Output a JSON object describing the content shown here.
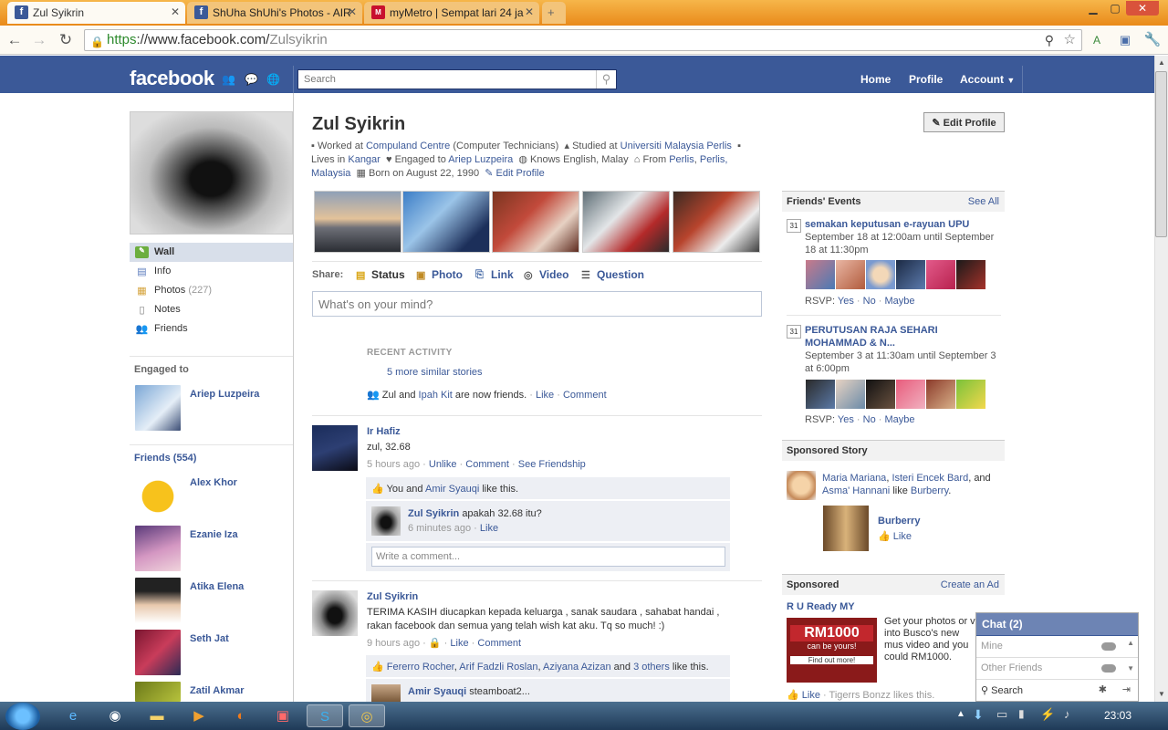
{
  "browser": {
    "tabs": [
      {
        "title": "Zul Syikrin",
        "icon": "facebook-icon"
      },
      {
        "title": "ShUha ShUhi's Photos - AIR",
        "icon": "facebook-icon"
      },
      {
        "title": "myMetro | Sempat lari 24 ja",
        "icon": "mymetro-icon"
      }
    ],
    "url_scheme": "https",
    "url_main": "://www.facebook.com/",
    "url_path": "Zulsyikrin"
  },
  "fb": {
    "logo": "facebook",
    "search_placeholder": "Search",
    "nav": {
      "home": "Home",
      "profile": "Profile",
      "account": "Account"
    }
  },
  "leftnav": {
    "items": [
      {
        "label": "Wall",
        "icon": "wall-icon"
      },
      {
        "label": "Info",
        "icon": "info-icon"
      },
      {
        "label": "Photos",
        "count": "(227)",
        "icon": "photos-icon"
      },
      {
        "label": "Notes",
        "icon": "notes-icon"
      },
      {
        "label": "Friends",
        "icon": "friends-icon"
      }
    ],
    "engaged_heading": "Engaged to",
    "engaged_name": "Ariep Luzpeira",
    "friends_heading": "Friends (554)",
    "friends": [
      "Alex Khor",
      "Ezanie Iza",
      "Atika Elena",
      "Seth Jat",
      "Zatil Akmar"
    ]
  },
  "profile": {
    "name": "Zul Syikrin",
    "edit_button": "Edit Profile",
    "worked_at": "Worked at",
    "workplace": "Compuland Centre",
    "work_role": "(Computer Technicians)",
    "studied_at": "Studied at",
    "school": "Universiti Malaysia Perlis",
    "lives_in": "Lives in",
    "city": "Kangar",
    "engaged_to": "Engaged to",
    "partner": "Ariep Luzpeira",
    "knows": "Knows English, Malay",
    "from": "From",
    "from_a": "Perlis",
    "from_b": "Perlis,",
    "from_c": "Malaysia",
    "born": "Born on August 22, 1990",
    "edit_profile_link": "Edit Profile"
  },
  "share": {
    "label": "Share:",
    "items": [
      "Status",
      "Photo",
      "Link",
      "Video",
      "Question"
    ],
    "placeholder": "What's on your mind?"
  },
  "feed": {
    "recent_heading": "RECENT ACTIVITY",
    "more_stories": "5 more similar stories",
    "friends_story_pre": "Zul and",
    "friends_story_name": "Ipah Kit",
    "friends_story_post": "are now friends.",
    "like": "Like",
    "comment": "Comment",
    "post1": {
      "author": "Ir Hafiz",
      "text": "zul, 32.68",
      "time": "5 hours ago",
      "unlike": "Unlike",
      "comment": "Comment",
      "see_friendship": "See Friendship",
      "likes_pre": "You and",
      "likes_name": "Amir Syauqi",
      "likes_post": "like this.",
      "reply_author": "Zul Syikrin",
      "reply_text": "apakah 32.68 itu?",
      "reply_time": "6 minutes ago",
      "reply_like": "Like",
      "write_comment": "Write a comment..."
    },
    "post2": {
      "author": "Zul Syikrin",
      "text": "TERIMA KASIH diucapkan kepada keluarga , sanak saudara , sahabat handai , rakan facebook dan semua yang telah wish kat aku. Tq so much! :)",
      "time": "9 hours ago",
      "like": "Like",
      "comment": "Comment",
      "likers": [
        "Fererro Rocher",
        "Arif Fadzli Roslan",
        "Aziyana Azizan"
      ],
      "likers_and": "and",
      "others": "3 others",
      "likes_post": "like this.",
      "reply_author": "Amir Syauqi",
      "reply_text": "steamboat2..."
    }
  },
  "right": {
    "events_heading": "Friends' Events",
    "see_all": "See All",
    "events": [
      {
        "title": "semakan keputusan e-rayuan UPU",
        "when": "September 18 at 12:00am until September 18 at 11:30pm",
        "rsvp": "RSVP:",
        "yes": "Yes",
        "no": "No",
        "maybe": "Maybe"
      },
      {
        "title": "PERUTUSAN RAJA SEHARI MOHAMMAD & N...",
        "when": "September 3 at 11:30am until September 3 at 6:00pm",
        "rsvp": "RSVP:",
        "yes": "Yes",
        "no": "No",
        "maybe": "Maybe"
      }
    ],
    "cal_label": "31",
    "sponsored_story_heading": "Sponsored Story",
    "ss_names": [
      "Maria Mariana",
      "Isteri Encek Bard",
      "Asma' Hannani"
    ],
    "ss_and": ", and",
    "ss_like": "like",
    "ss_brand": "Burberry",
    "ss_product": "Burberry",
    "ss_like_btn": "Like",
    "sponsored_heading": "Sponsored",
    "create_ad": "Create an Ad",
    "ad_title": "R U Ready MY",
    "ad_image_line1": "RM1000",
    "ad_image_line2": "can be yours!",
    "ad_image_line3": "Find out more!",
    "ad_text": "Get your photos or v into Busco's new mus video and you could RM1000. Keep it stea",
    "ad_like": "Like",
    "ad_likes": "Tigerrs Bonzz likes this."
  },
  "chat": {
    "title": "Chat (2)",
    "rows": [
      "Mine",
      "Other Friends"
    ],
    "search": "Search"
  },
  "taskbar": {
    "clock": "23:03"
  }
}
